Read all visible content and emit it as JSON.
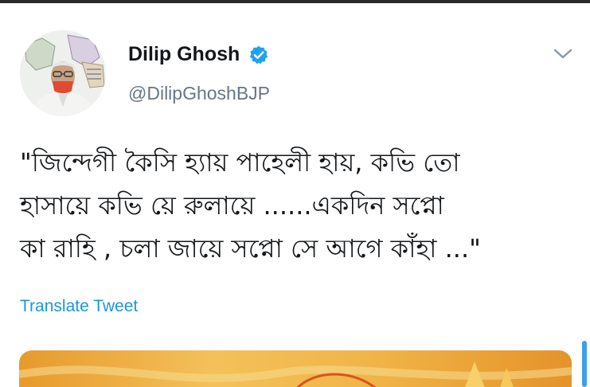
{
  "tweet": {
    "author": {
      "display_name": "Dilip Ghosh",
      "handle": "@DilipGhoshBJP",
      "verified": true,
      "avatar_icon": "profile-photo"
    },
    "menu_icon": "chevron-down-icon",
    "text_lines": [
      "\"জিন্দেগী কৈসি হ্যায় পাহেলী হায়, কভি তো",
      "হাসায়ে কভি য়ে  রুলায়ে ......একদিন সপ্নো",
      "কা রাহি , চলা জায়ে সপ্নো সে আগে কাঁহা ...\""
    ],
    "translate_label": "Translate Tweet"
  },
  "colors": {
    "text": "#14171a",
    "secondary": "#657786",
    "link": "#1b95e0",
    "verified": "#1da1f2"
  }
}
